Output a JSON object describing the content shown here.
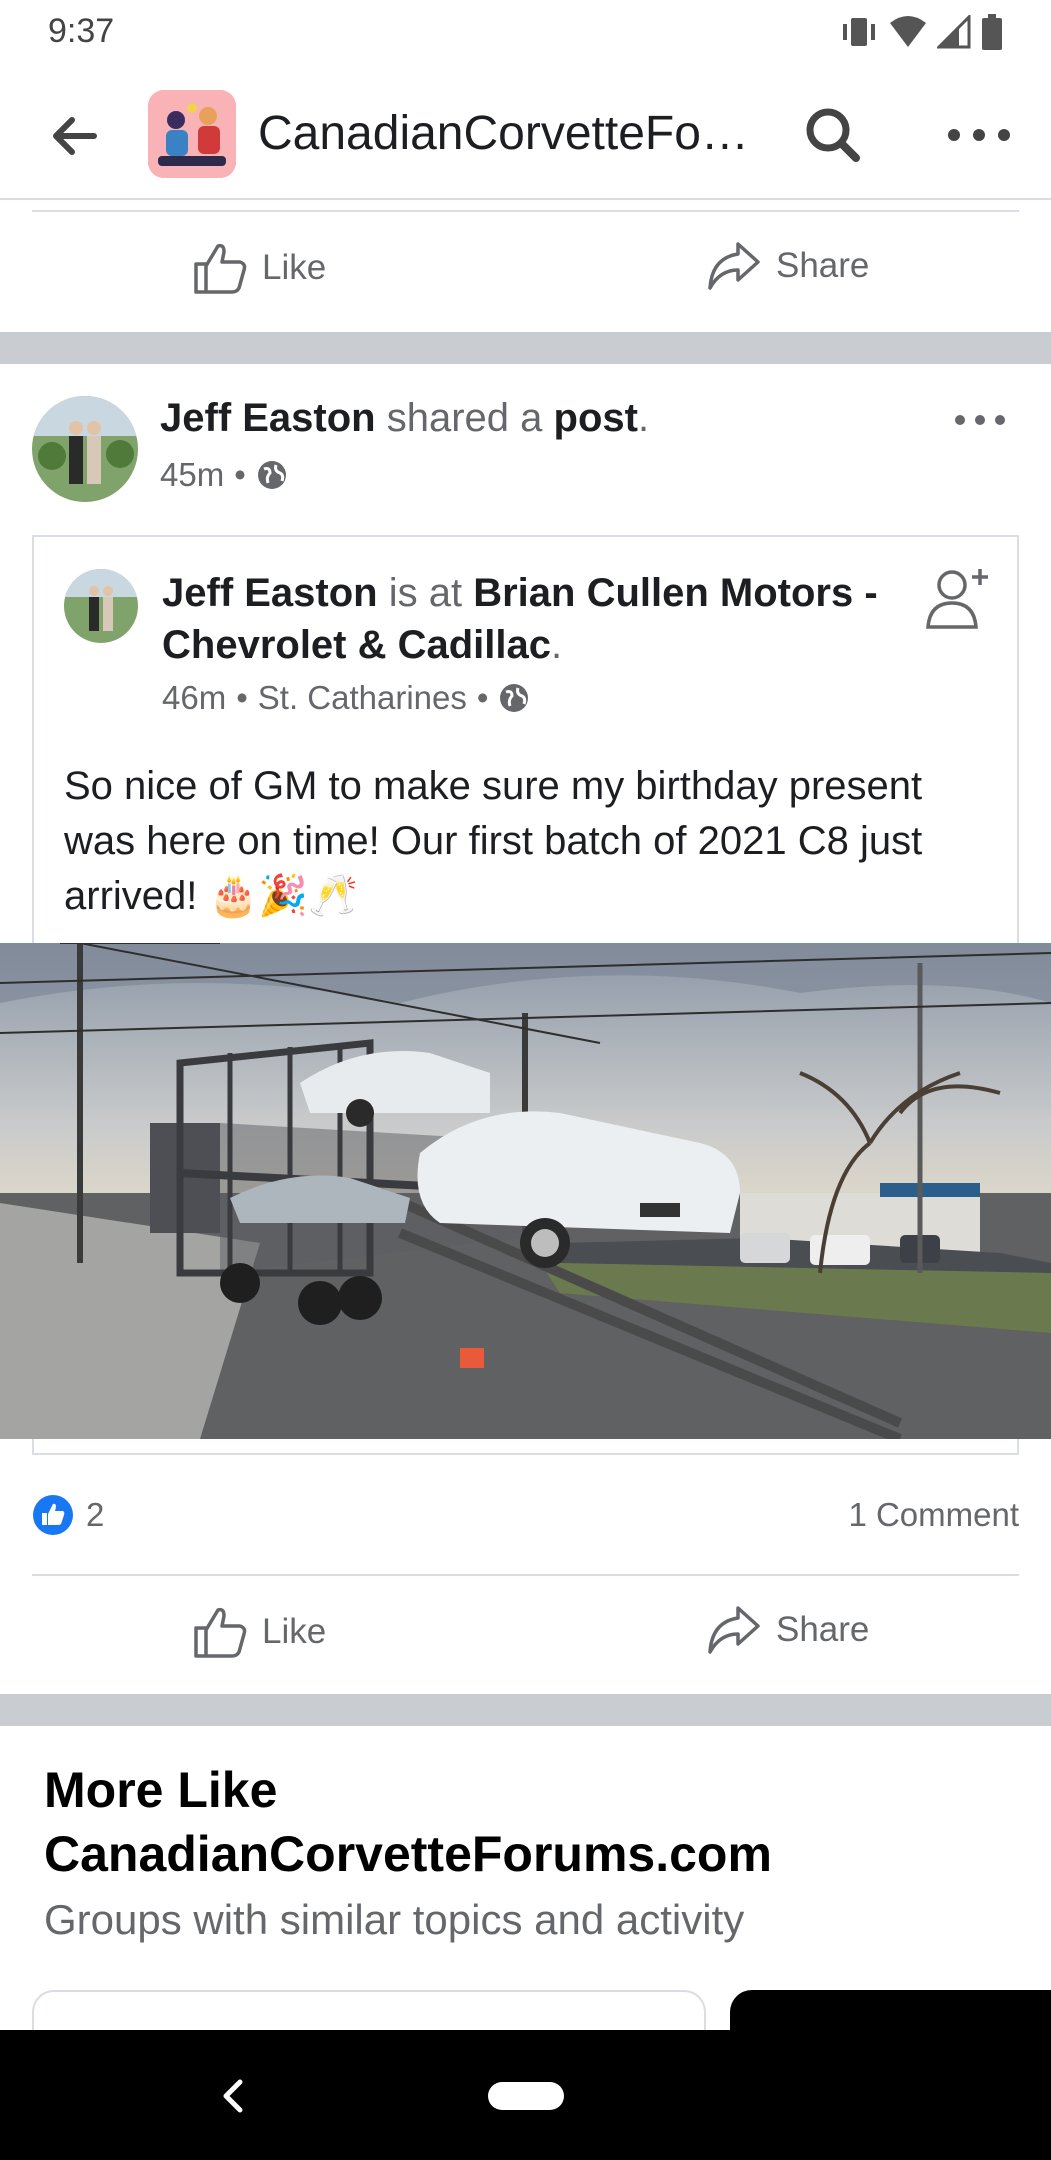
{
  "status_bar": {
    "time": "9:37"
  },
  "app_bar": {
    "title": "CanadianCorvetteForu…"
  },
  "top_actions": {
    "like": "Like",
    "share": "Share"
  },
  "post": {
    "author": "Jeff Easton",
    "action_prefix": "shared a",
    "action_object": "post",
    "action_suffix": ".",
    "time": "45m",
    "shared": {
      "author": "Jeff Easton",
      "connector": "is at",
      "place": "Brian Cullen Motors - Chevrolet & Cadillac",
      "place_suffix": ".",
      "time": "46m",
      "location": "St. Catharines",
      "text": "So nice of GM to make sure my birthday present was here on time! Our first batch of 2021 C8 just arrived!",
      "emojis": "🎂🎉🥂"
    },
    "reaction_count": "2",
    "comments": "1 Comment",
    "like": "Like",
    "share": "Share"
  },
  "more_like": {
    "title": "More Like CanadianCorvetteForums.com",
    "subtitle": "Groups with similar topics and activity"
  },
  "colors": {
    "brand_blue": "#1877f2",
    "secondary_text": "#65676b",
    "divider": "#dadde1"
  }
}
